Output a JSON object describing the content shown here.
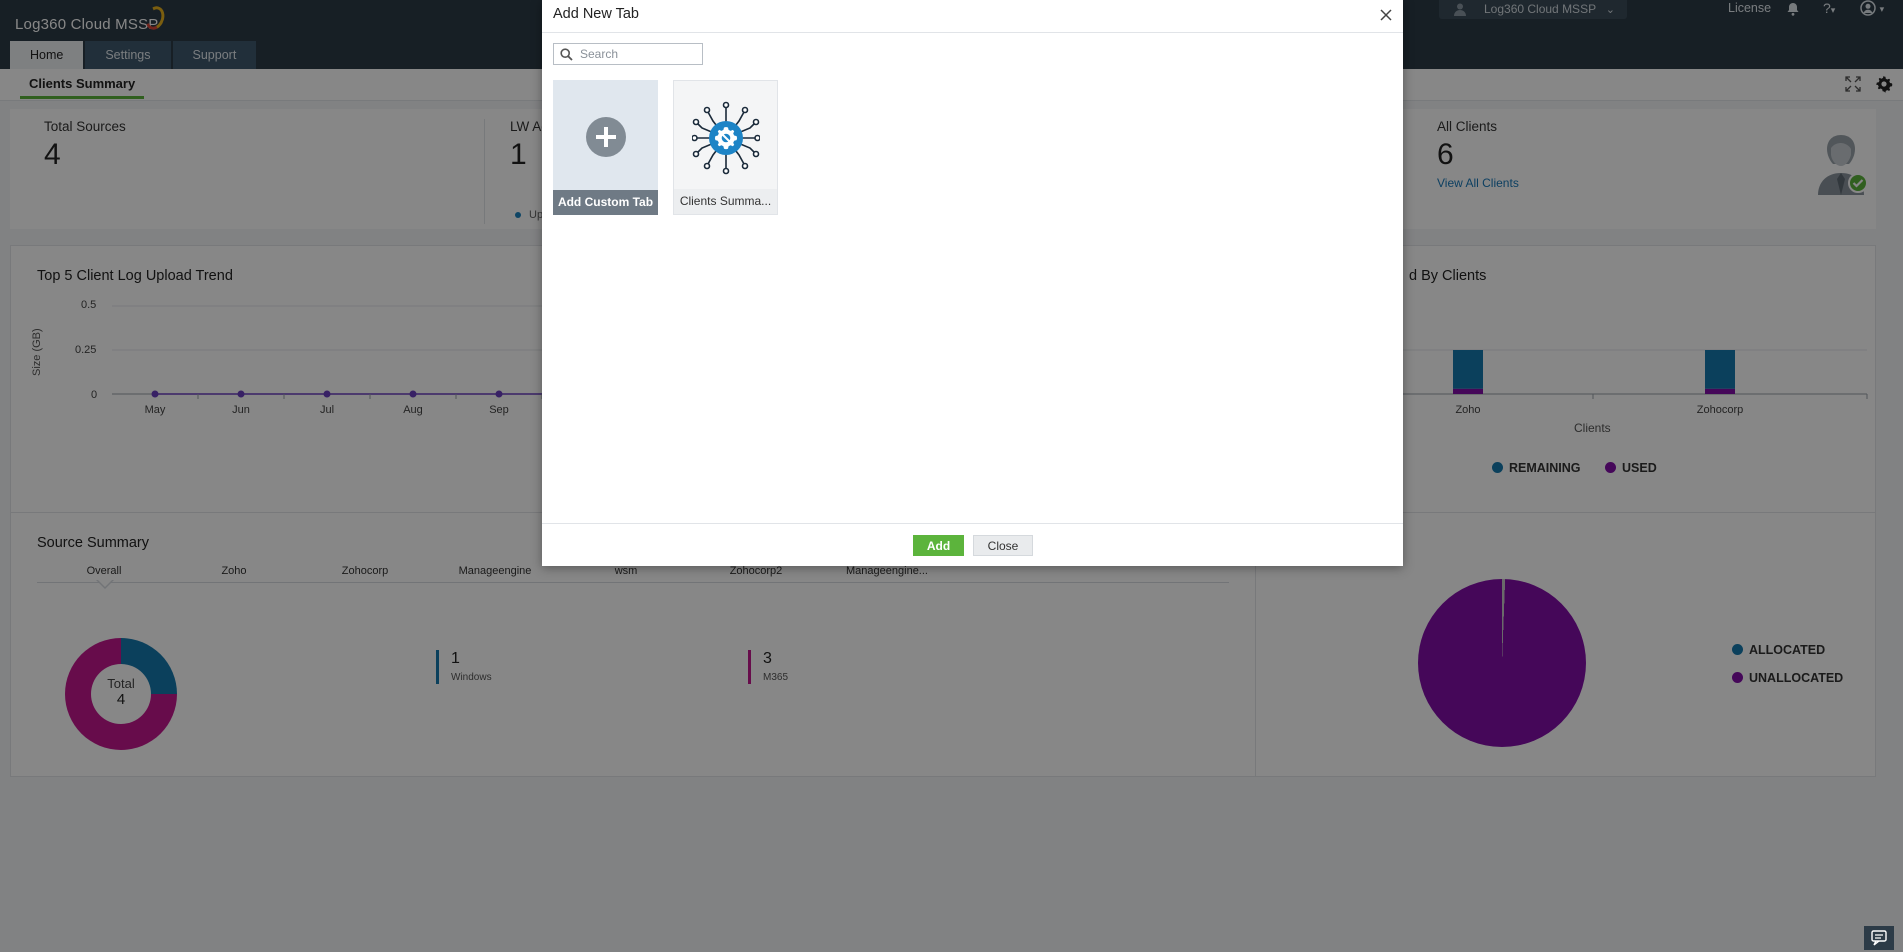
{
  "header": {
    "logo_text": "Log360 Cloud MSSP",
    "tabs": [
      {
        "label": "Home",
        "active": true
      },
      {
        "label": "Settings",
        "active": false
      },
      {
        "label": "Support",
        "active": false
      }
    ],
    "org_selector": "Log360 Cloud MSSP",
    "license_label": "License",
    "help_label": "?"
  },
  "subheader": {
    "active_tab": "Clients Summary"
  },
  "kpis": {
    "total_sources": {
      "label": "Total Sources",
      "value": "4"
    },
    "lw_agents": {
      "label": "LW Ag",
      "value": "1",
      "legend": "Up"
    },
    "all_clients": {
      "label": "All Clients",
      "value": "6",
      "link": "View All Clients"
    }
  },
  "trend_panel": {
    "title": "Top 5 Client Log Upload Trend",
    "chart_data": {
      "type": "line",
      "title": "Top 5 Client Log Upload Trend",
      "ylabel": "Size (GB)",
      "xlabel": "",
      "ylim": [
        0,
        0.5
      ],
      "y_ticks": [
        "0.5",
        "0.25",
        "0"
      ],
      "categories": [
        "May",
        "Jun",
        "Jul",
        "Aug",
        "Sep"
      ],
      "series": [
        {
          "values": [
            0,
            0,
            0,
            0,
            0
          ],
          "color": "#6a3fbf"
        }
      ],
      "grid": true
    }
  },
  "clients_panel": {
    "title": "d By Clients",
    "chart_data": {
      "type": "bar",
      "categories": [
        "Zoho",
        "Zohocorp"
      ],
      "xlabel": "Clients",
      "series": [
        {
          "name": "REMAINING",
          "color": "#1679ae",
          "values": [
            0.88,
            0.88
          ]
        },
        {
          "name": "USED",
          "color": "#820ea9",
          "values": [
            0.12,
            0.12
          ]
        }
      ],
      "legend": "bottom"
    }
  },
  "source_panel": {
    "title": "Source Summary",
    "tabs": [
      "Overall",
      "Zoho",
      "Zohocorp",
      "Manageengine",
      "wsm",
      "Zohocorp2",
      "Manageengine..."
    ],
    "donut": {
      "label": "Total",
      "value": "4"
    },
    "chart_data": {
      "type": "pie",
      "categories": [
        "Windows",
        "M365"
      ],
      "values": [
        1,
        3
      ],
      "colors": [
        "#1679ae",
        "#c3178f"
      ]
    },
    "stats": [
      {
        "value": "1",
        "label": "Windows",
        "color": "#1679ae"
      },
      {
        "value": "3",
        "label": "M365",
        "color": "#c3178f"
      }
    ]
  },
  "allocation_panel": {
    "chart_data": {
      "type": "pie",
      "categories": [
        "ALLOCATED",
        "UNALLOCATED"
      ],
      "values": [
        0.6,
        99.4
      ],
      "colors": [
        "#1679ae",
        "#820ea9"
      ],
      "legend": "right"
    },
    "legend": [
      {
        "label": "ALLOCATED",
        "color": "#1679ae"
      },
      {
        "label": "UNALLOCATED",
        "color": "#820ea9"
      }
    ]
  },
  "modal": {
    "title": "Add New Tab",
    "search_placeholder": "Search",
    "search_value": "",
    "tiles": [
      {
        "label": "Add Custom Tab",
        "icon": "plus-circle-icon"
      },
      {
        "label": "Clients Summa...",
        "icon": "network-hub-icon"
      }
    ],
    "add_label": "Add",
    "close_label": "Close"
  }
}
